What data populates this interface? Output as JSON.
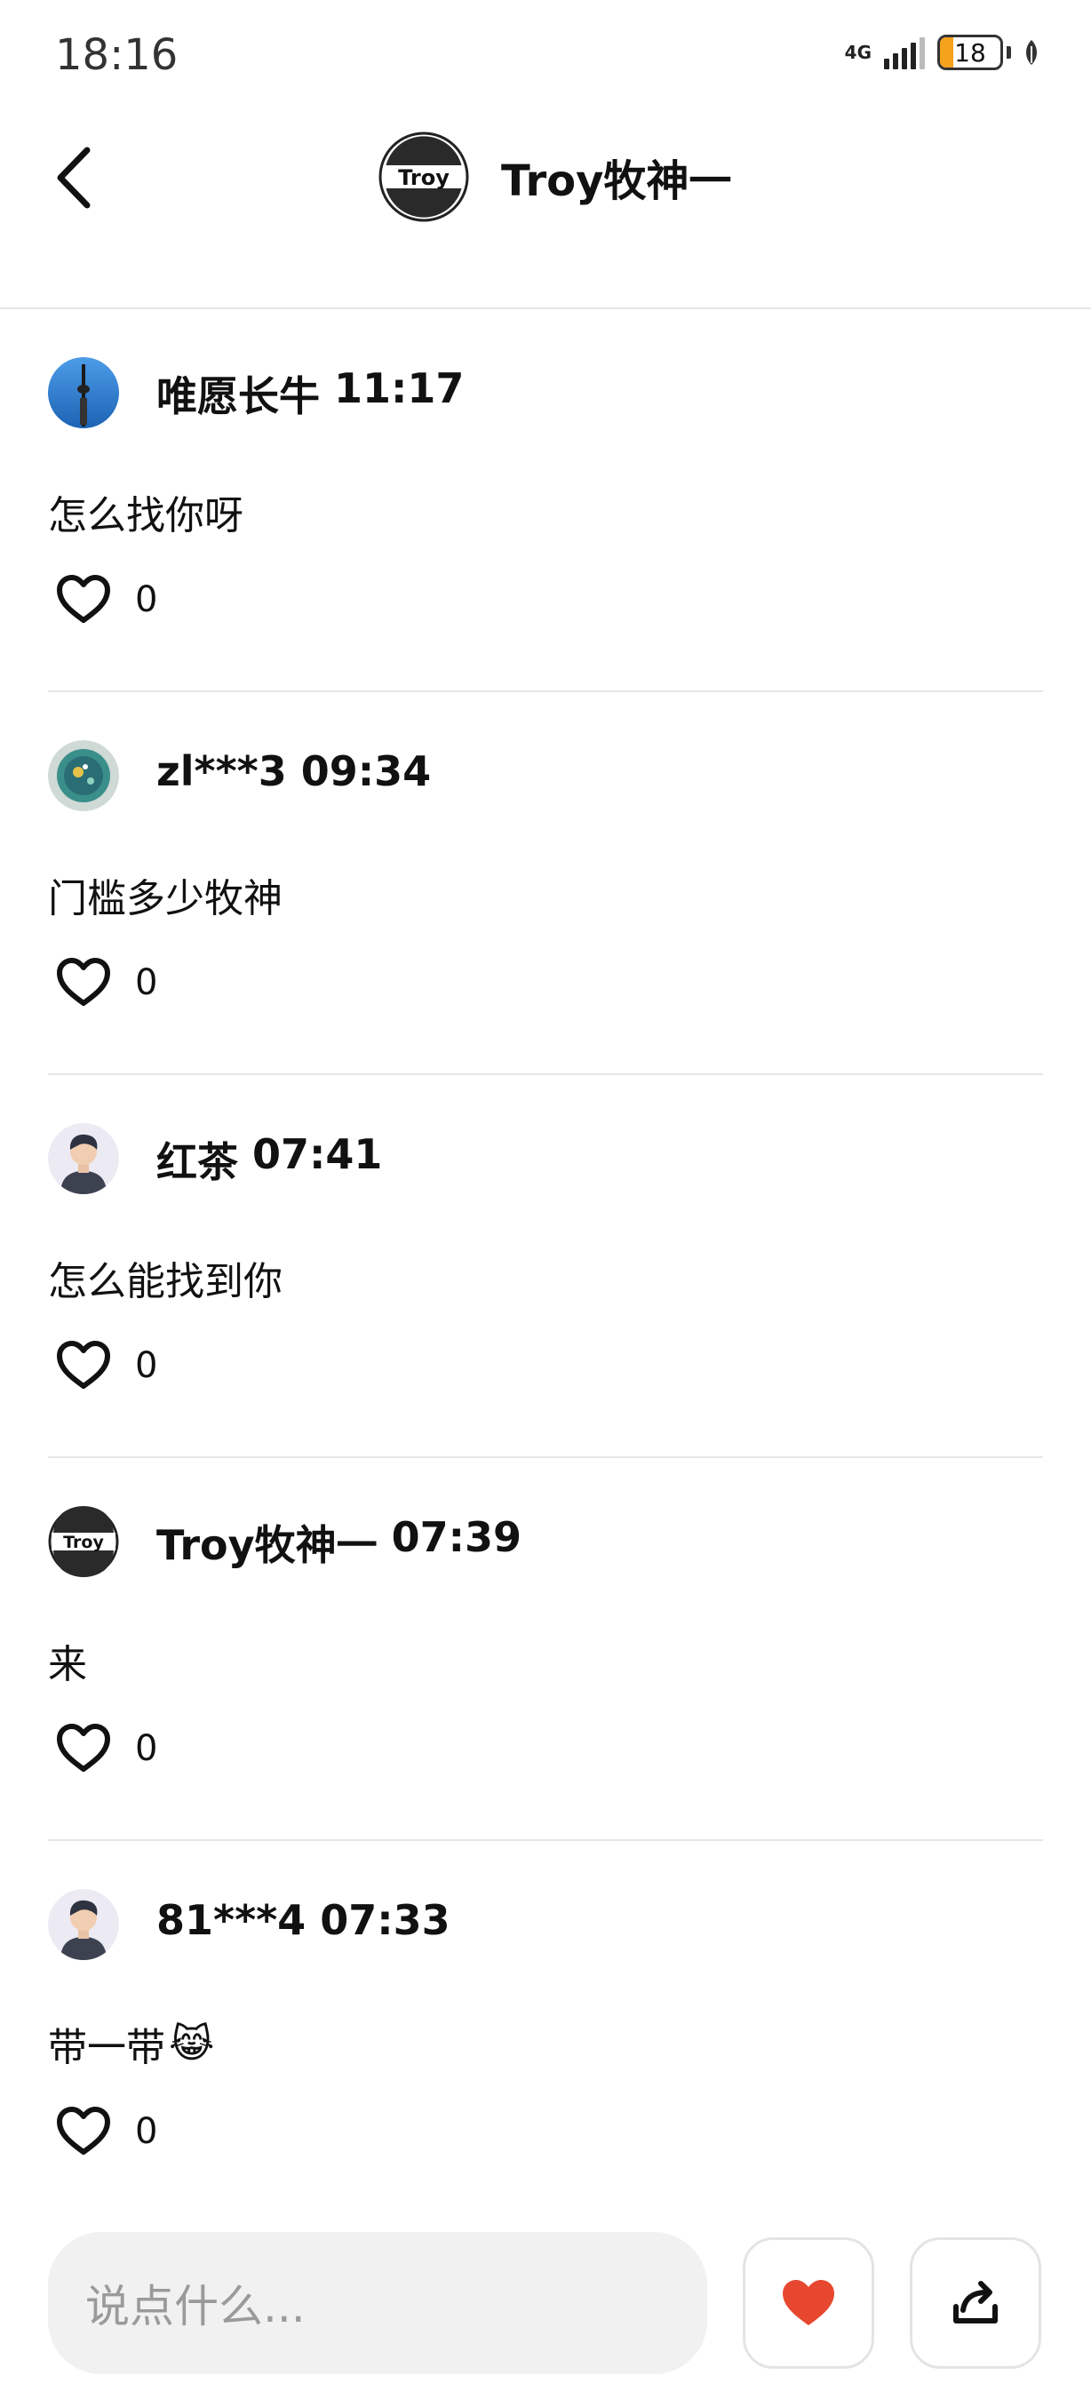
{
  "status_bar": {
    "time": "18:16",
    "network": "4G",
    "battery": "18",
    "battery_color": "#f4a11c"
  },
  "header": {
    "back_icon": "chevron-left-icon",
    "title": "Troy牧神一",
    "avatar_text": "Troy"
  },
  "comments": [
    {
      "user": "唯愿长牛",
      "time": "11:17",
      "text": "怎么找你呀",
      "likes": "0",
      "avatar": "tower-avatar"
    },
    {
      "user": "zl***3",
      "time": "09:34",
      "text": "门槛多少牧神",
      "likes": "0",
      "avatar": "aquarium-avatar"
    },
    {
      "user": "红茶",
      "time": "07:41",
      "text": "怎么能找到你",
      "likes": "0",
      "avatar": "default-person-avatar"
    },
    {
      "user": "Troy牧神一",
      "time": "07:39",
      "text": "来",
      "likes": "0",
      "avatar": "troy-logo-avatar"
    },
    {
      "user": "81***4",
      "time": "07:33",
      "text": "带一带",
      "emoji": "😹",
      "likes": "0",
      "avatar": "default-person-avatar"
    }
  ],
  "bottom_bar": {
    "placeholder": "说点什么...",
    "like_color": "#e8472f",
    "share_icon": "share-icon"
  }
}
